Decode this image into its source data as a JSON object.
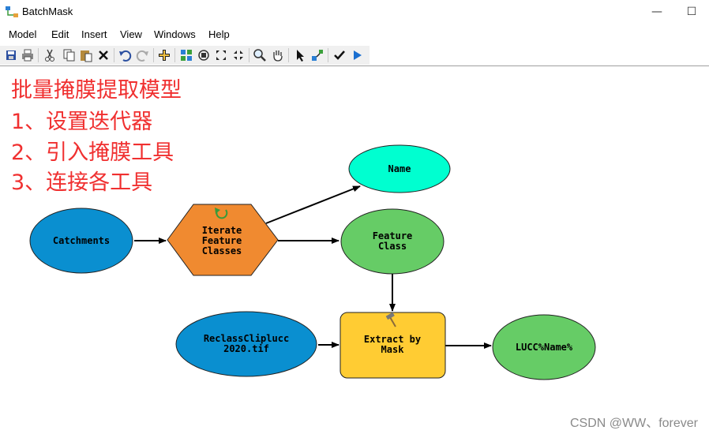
{
  "window": {
    "title": "BatchMask",
    "minimize_glyph": "—",
    "maximize_glyph": "☐"
  },
  "menu": [
    "Model",
    "Edit",
    "Insert",
    "View",
    "Windows",
    "Help"
  ],
  "toolbar": {
    "buttons": [
      "save-icon",
      "print-icon",
      "cut-icon",
      "copy-icon",
      "paste-icon",
      "delete-icon",
      "undo-icon",
      "redo-icon",
      "add-data-icon",
      "auto-layout-icon",
      "full-extent-icon",
      "zoom-in-fixed-icon",
      "zoom-out-fixed-icon",
      "zoom-icon",
      "pan-icon",
      "select-icon",
      "connect-icon",
      "validate-icon",
      "run-icon"
    ]
  },
  "annotation": {
    "line1": "批量掩膜提取模型",
    "line2": "1、设置迭代器",
    "line3": "2、引入掩膜工具",
    "line4": "3、连接各工具"
  },
  "model": {
    "catchments": "Catchments",
    "iterate_l1": "Iterate",
    "iterate_l2": "Feature",
    "iterate_l3": "Classes",
    "name": "Name",
    "feature_class_l1": "Feature",
    "feature_class_l2": "Class",
    "reclass_l1": "ReclassCliplucc",
    "reclass_l2": "2020.tif",
    "extract_l1": "Extract by",
    "extract_l2": "Mask",
    "output": "LUCC%Name%"
  },
  "colors": {
    "input_blue": "#0a8fd0",
    "iterator_orange": "#f08a30",
    "variable_cyan": "#00ffd0",
    "output_green": "#66cc66",
    "tool_yellow": "#ffcc33",
    "annotation_red": "#f03030"
  },
  "watermark": "CSDN @WW、forever"
}
